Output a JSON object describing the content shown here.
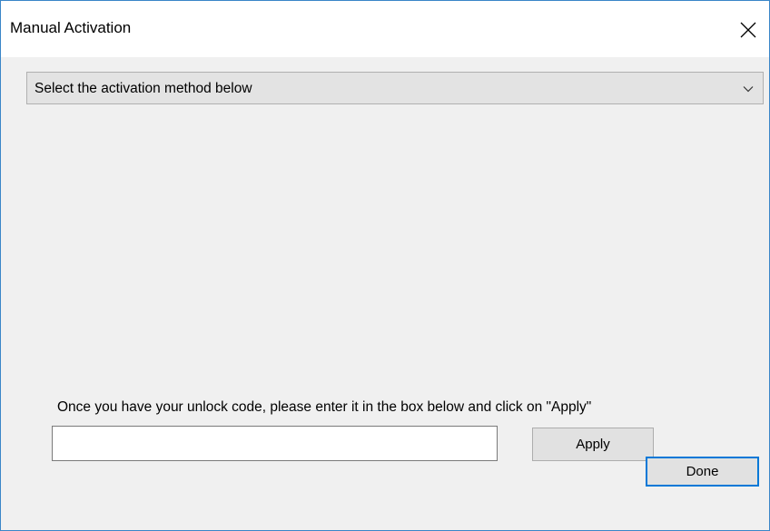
{
  "window": {
    "title": "Manual Activation"
  },
  "titlebar": {
    "close_icon": "close-icon"
  },
  "activation_method": {
    "selected_value": "Select the activation method below",
    "chevron_icon": "chevron-down-icon"
  },
  "unlock": {
    "instructions": "Once you have your unlock code, please enter it in the box below and click on \"Apply\"",
    "input_value": "",
    "apply_label": "Apply"
  },
  "footer": {
    "done_label": "Done"
  },
  "colors": {
    "window_border": "#3a86c8",
    "dialog_background": "#f0f0f0",
    "default_button_border": "#0078d7"
  }
}
